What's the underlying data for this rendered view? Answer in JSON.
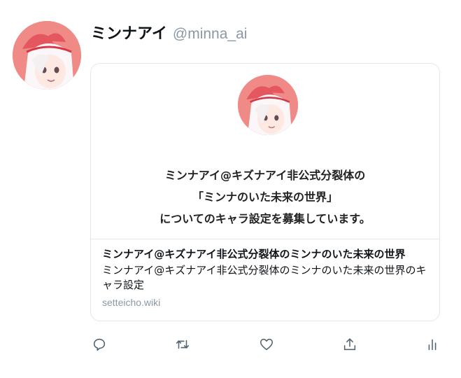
{
  "tweet": {
    "display_name": "ミンナアイ",
    "handle": "@minna_ai",
    "avatar_icon": "anime-girl-avatar-icon"
  },
  "card": {
    "caption_lines": [
      "ミンナアイ@キズナアイ非公式分裂体の",
      "「ミンナのいた未来の世界」",
      "についてのキャラ設定を募集しています。"
    ],
    "title": "ミンナアイ@キズナアイ非公式分裂体のミンナのいた未来の世界",
    "description": "ミンナアイ@キズナアイ非公式分裂体のミンナのいた未来の世界のキャラ設定",
    "domain": "setteicho.wiki"
  },
  "actions": {
    "reply_icon": "reply-icon",
    "retweet_icon": "retweet-icon",
    "like_icon": "heart-icon",
    "share_icon": "share-icon",
    "analytics_icon": "analytics-icon"
  },
  "colors": {
    "avatar_bg": "#f08a86",
    "muted_text": "#8b98a5",
    "border": "#e1e8ed",
    "icon": "#536471"
  }
}
